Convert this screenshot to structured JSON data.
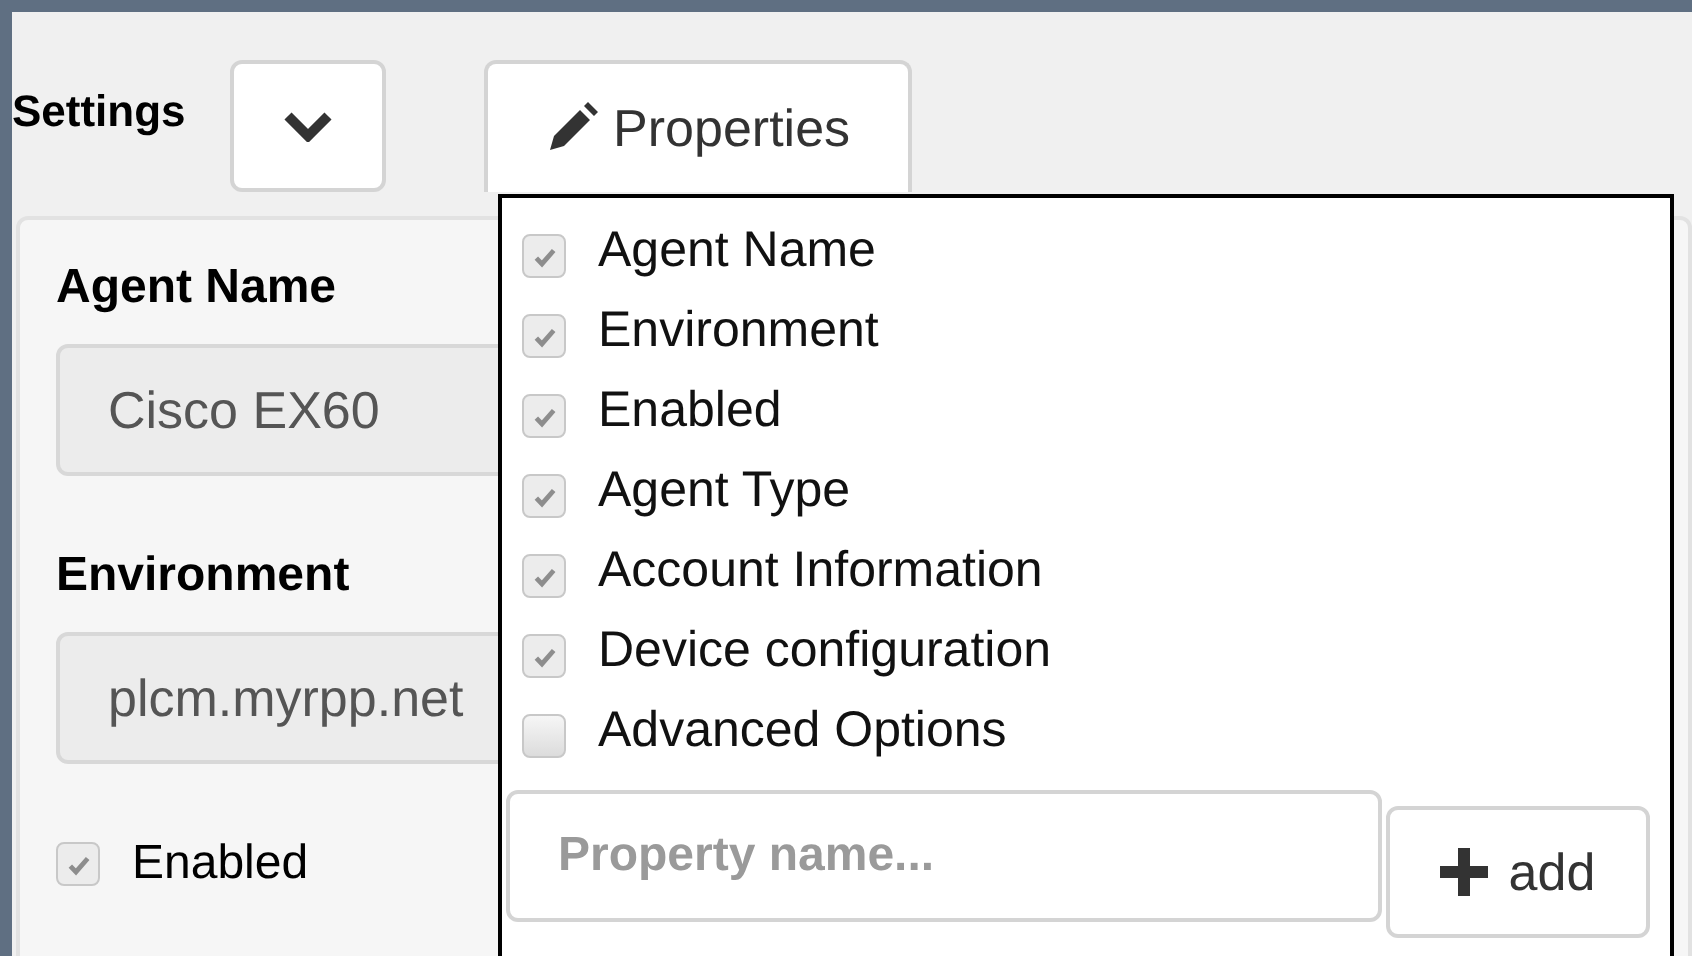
{
  "header": {
    "title": "Settings",
    "properties_button": "Properties"
  },
  "form": {
    "fields": [
      {
        "label": "Agent Name",
        "value": "Cisco EX60"
      },
      {
        "label": "Environment",
        "value": "plcm.myrpp.net"
      }
    ],
    "enabled": {
      "label": "Enabled",
      "checked": true
    }
  },
  "properties_menu": {
    "items": [
      {
        "label": "Agent Name",
        "checked": true
      },
      {
        "label": "Environment",
        "checked": true
      },
      {
        "label": "Enabled",
        "checked": true
      },
      {
        "label": "Agent Type",
        "checked": true
      },
      {
        "label": "Account Information",
        "checked": true
      },
      {
        "label": "Device configuration",
        "checked": true
      },
      {
        "label": "Advanced Options",
        "checked": false
      }
    ],
    "new_property": {
      "placeholder": "Property name..."
    },
    "add_button": "add"
  }
}
